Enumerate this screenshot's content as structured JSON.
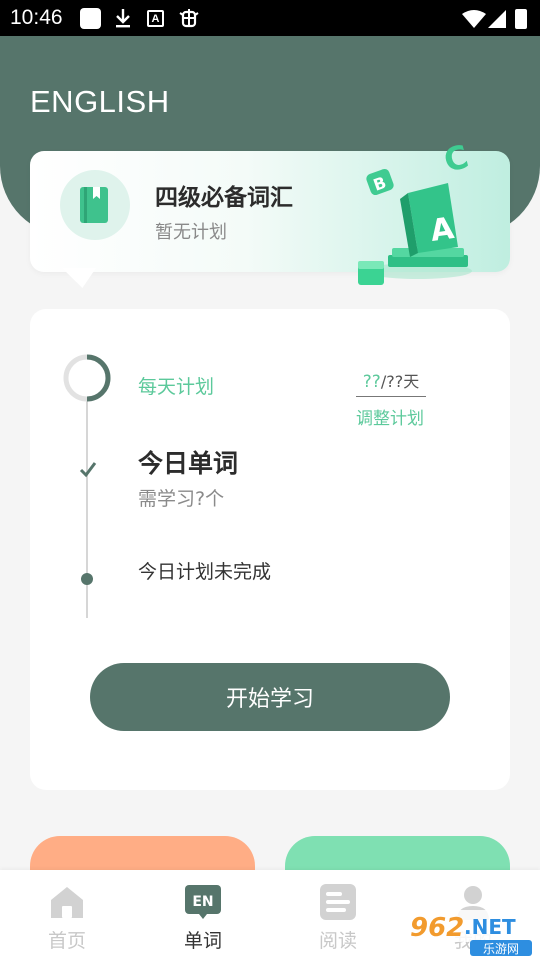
{
  "status_bar": {
    "time": "10:46"
  },
  "header": {
    "title": "ENGLISH"
  },
  "book": {
    "name": "四级必备词汇",
    "plan": "暂无计划"
  },
  "plan": {
    "daily_label": "每天计划",
    "ratio_done": "??",
    "ratio_sep": "/",
    "ratio_total": "??天",
    "adjust_label": "调整计划",
    "today_title": "今日单词",
    "today_need": "需学习?个",
    "today_status": "今日计划未完成"
  },
  "start_button": "开始学习",
  "tabs": [
    {
      "label": "首页",
      "icon": "home-icon",
      "active": false
    },
    {
      "label": "单词",
      "icon": "en-book-icon",
      "active": true,
      "badge": "EN"
    },
    {
      "label": "阅读",
      "icon": "document-icon",
      "active": false
    },
    {
      "label": "我的",
      "icon": "person-icon",
      "active": false
    }
  ],
  "watermark": {
    "main": "962.NET",
    "sub": "乐游网"
  },
  "colors": {
    "primary": "#56756b",
    "accent": "#5cc99b",
    "orange": "#ffad85",
    "mint": "#7fe0b2"
  }
}
